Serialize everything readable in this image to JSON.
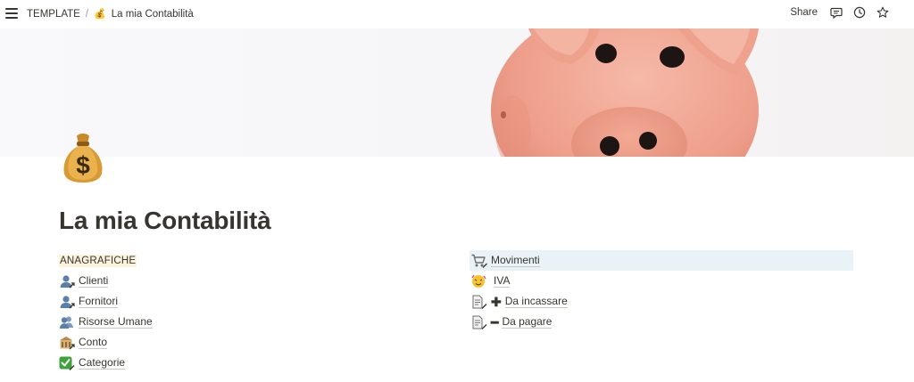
{
  "topbar": {
    "breadcrumb_root": "TEMPLATE",
    "breadcrumb_separator": "/",
    "breadcrumb_page_emoji": "💰",
    "breadcrumb_page": "La mia Contabilità",
    "share_label": "Share",
    "icons": [
      "menu-icon",
      "comments-icon",
      "history-icon",
      "favorite-star-icon"
    ]
  },
  "cover": {
    "description_icon": "piggy-bank-cover-image",
    "piggy_color": "#f1a795"
  },
  "page": {
    "icon": "money-bag-icon",
    "title": "La mia Contabilità"
  },
  "left_column": {
    "heading": "ANAGRAFICHE",
    "links": [
      {
        "emoji": "bust-link-icon",
        "label": "Clienti"
      },
      {
        "emoji": "bust-link-icon",
        "label": "Fornitori"
      },
      {
        "emoji": "busts-link-icon",
        "label": "Risorse Umane"
      },
      {
        "emoji": "bank-link-icon",
        "label": "Conto"
      },
      {
        "emoji": "check-mark-link-icon",
        "label": "Categorie"
      }
    ]
  },
  "right_column": {
    "links": [
      {
        "emoji": "cart-link-icon",
        "sign": "",
        "label": "Movimenti"
      },
      {
        "emoji": "face-link-icon",
        "sign": "",
        "label": "IVA"
      },
      {
        "emoji": "document-link-icon",
        "sign": "✚",
        "label": "Da incassare"
      },
      {
        "emoji": "document-link-icon",
        "sign": "━",
        "label": "Da pagare"
      }
    ]
  },
  "colors": {
    "text": "#37352f",
    "hover_row": "#e9f3f7",
    "heading_highlight": "#fbf3db"
  }
}
